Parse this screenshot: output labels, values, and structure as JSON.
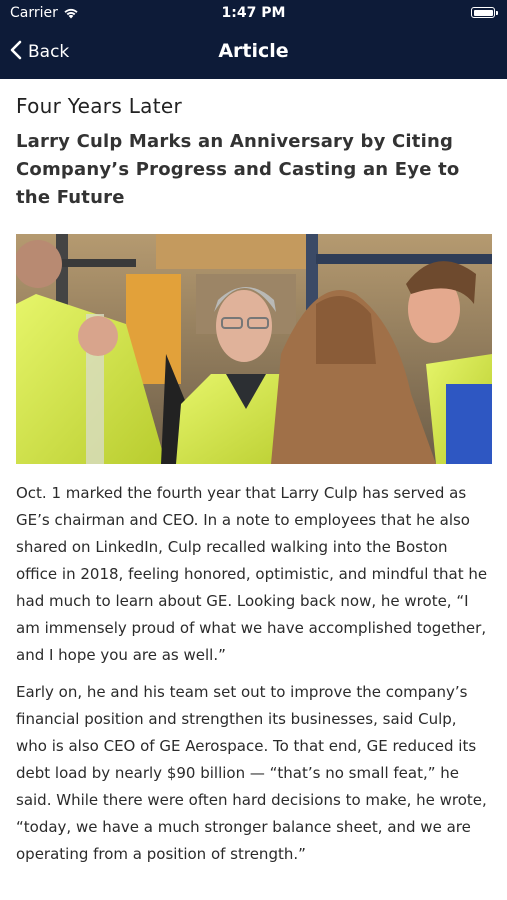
{
  "status_bar": {
    "carrier": "Carrier",
    "time": "1:47 PM"
  },
  "nav": {
    "back_label": "Back",
    "title": "Article"
  },
  "article": {
    "headline": "Four Years Later",
    "subheadline": "Larry Culp Marks an Anniversary by Citing Company’s Progress and Casting an Eye to the Future",
    "image_alt": "",
    "paragraphs": [
      "Oct. 1 marked the fourth year that Larry Culp has served as GE’s chairman and CEO. In a note to employees that he also shared on LinkedIn, Culp recalled walking into the Boston office in 2018, feeling honored, optimistic, and mindful that he had much to learn about GE. Looking back now, he wrote, “I am immensely proud of what we have accomplished together, and I hope you are as well.”",
      "Early on, he and his team set out to improve the company’s financial position and strengthen its businesses, said Culp, who is also CEO of GE Aerospace. To that end, GE reduced its debt load by nearly $90 billion — “that’s no small feat,” he said. While there were often hard decisions to make, he wrote, “today, we have a much stronger balance sheet, and we are operating from a position of strength.”"
    ]
  },
  "colors": {
    "nav_background": "#0d1b38",
    "text": "#222222"
  }
}
